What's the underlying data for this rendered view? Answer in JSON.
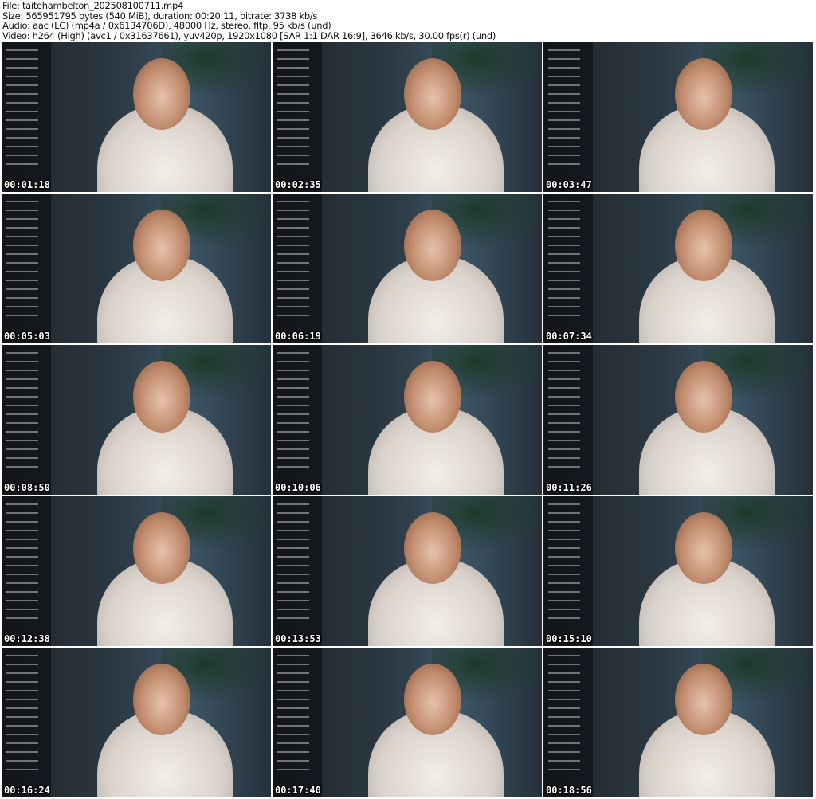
{
  "header": {
    "file": "File: taitehambelton_202508100711.mp4",
    "size": "Size: 565951795 bytes (540 MiB), duration: 00:20:11, bitrate: 3738 kb/s",
    "audio": "Audio: aac (LC) (mp4a / 0x6134706D), 48000 Hz, stereo, fltp, 95 kb/s (und)",
    "video": "Video: h264 (High) (avc1 / 0x31637661), yuv420p, 1920x1080 [SAR 1:1 DAR 16:9], 3646 kb/s, 30.00 fps(r) (und)"
  },
  "thumbnails": [
    {
      "timestamp": "00:01:18"
    },
    {
      "timestamp": "00:02:35"
    },
    {
      "timestamp": "00:03:47"
    },
    {
      "timestamp": "00:05:03"
    },
    {
      "timestamp": "00:06:19"
    },
    {
      "timestamp": "00:07:34"
    },
    {
      "timestamp": "00:08:50"
    },
    {
      "timestamp": "00:10:06"
    },
    {
      "timestamp": "00:11:26"
    },
    {
      "timestamp": "00:12:38"
    },
    {
      "timestamp": "00:13:53"
    },
    {
      "timestamp": "00:15:10"
    },
    {
      "timestamp": "00:16:24"
    },
    {
      "timestamp": "00:17:40"
    },
    {
      "timestamp": "00:18:56"
    }
  ]
}
